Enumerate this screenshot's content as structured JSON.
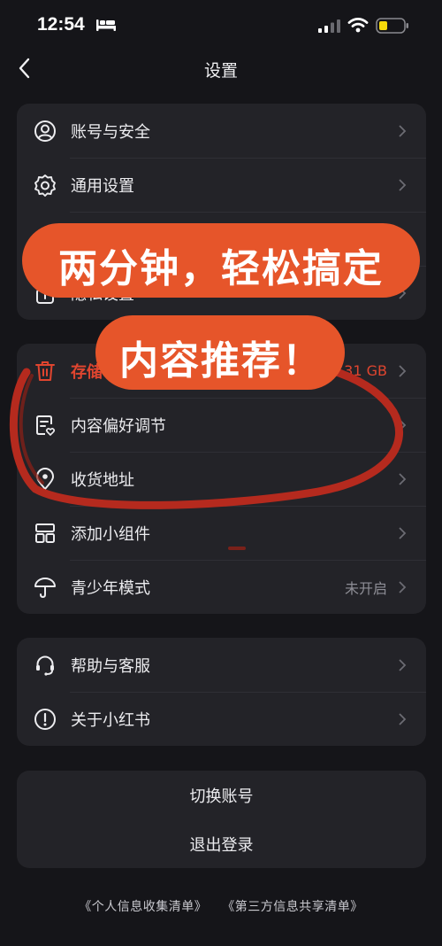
{
  "status": {
    "time": "12:54"
  },
  "nav": {
    "title": "设置"
  },
  "group1": [
    {
      "label": "账号与安全",
      "icon": "user-circle-icon"
    },
    {
      "label": "通用设置",
      "icon": "gear-icon"
    },
    {
      "label": "",
      "icon": ""
    },
    {
      "label": "隐私设置",
      "icon": "lock-icon"
    }
  ],
  "group2": [
    {
      "label": "存储",
      "value": ".31 GB",
      "icon": "trash-icon"
    },
    {
      "label": "内容偏好调节",
      "icon": "content-preference-icon"
    },
    {
      "label": "收货地址",
      "icon": "location-pin-icon"
    },
    {
      "label": "添加小组件",
      "icon": "widget-icon"
    },
    {
      "label": "青少年模式",
      "value": "未开启",
      "icon": "umbrella-icon"
    }
  ],
  "group3": [
    {
      "label": "帮助与客服",
      "icon": "headset-icon"
    },
    {
      "label": "关于小红书",
      "icon": "info-icon"
    }
  ],
  "actions": {
    "switch_account": "切换账号",
    "logout": "退出登录"
  },
  "footer": {
    "link1": "《个人信息收集清单》",
    "link2": "《第三方信息共享清单》"
  },
  "overlay": {
    "line1": "两分钟，轻松搞定",
    "line2": "内容推荐！"
  },
  "colors": {
    "accent": "#e6552a",
    "storage_red": "#e0452f",
    "annotation": "#b52a1e"
  }
}
